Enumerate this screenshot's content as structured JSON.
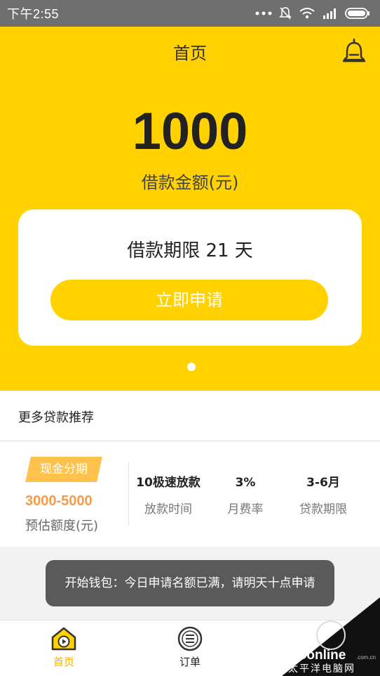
{
  "status_bar": {
    "time": "下午2:55",
    "icons": [
      "more-dots-icon",
      "mute-icon",
      "wifi-icon",
      "signal-icon",
      "battery-icon"
    ]
  },
  "header": {
    "title": "首页",
    "right_icon": "bell-icon"
  },
  "hero": {
    "amount": "1000",
    "amount_label": "借款金额(元)",
    "term_text": "借款期限 21 天",
    "apply_button": "立即申请",
    "pager": {
      "count": 1,
      "active_index": 0
    }
  },
  "recommend": {
    "section_title": "更多贷款推荐",
    "product": {
      "tag": "现金分期",
      "range": "3000-5000",
      "range_label": "预估额度(元)",
      "stats": [
        {
          "value": "10极速放款",
          "label": "放款时间"
        },
        {
          "value": "3%",
          "label": "月费率"
        },
        {
          "value": "3-6月",
          "label": "贷款期限"
        }
      ]
    }
  },
  "toast": {
    "text": "开始钱包：今日申请名额已满，请明天十点申请"
  },
  "bottom_nav": {
    "items": [
      {
        "label": "首页",
        "icon": "home-icon",
        "active": true
      },
      {
        "label": "订单",
        "icon": "orders-icon",
        "active": false
      }
    ]
  },
  "watermark": {
    "brand": "PConline",
    "sub": "太平洋电脑网",
    "domain": ".com.cn"
  },
  "colors": {
    "brand_yellow": "#ffd200",
    "tag_orange": "#ffc34d",
    "range_orange": "#f39c4d",
    "nav_active": "#f2b400",
    "status_bar": "#6f6f6f",
    "toast_bg": "#5a5a5a"
  }
}
